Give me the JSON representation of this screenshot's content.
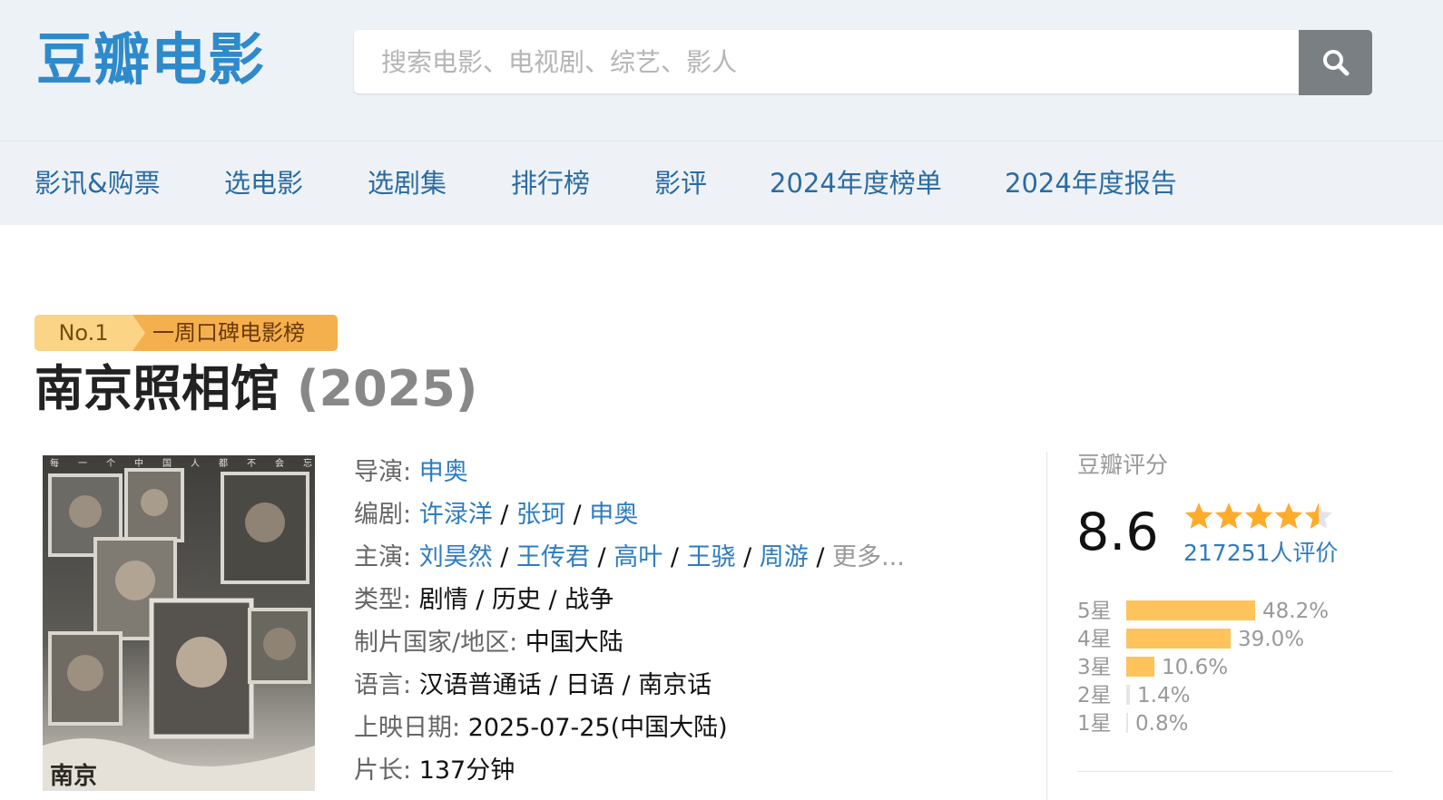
{
  "site": {
    "logo": "豆瓣电影"
  },
  "search": {
    "placeholder": "搜索电影、电视剧、综艺、影人",
    "value": ""
  },
  "nav": {
    "items": [
      {
        "label": "影讯&购票"
      },
      {
        "label": "选电影"
      },
      {
        "label": "选剧集"
      },
      {
        "label": "排行榜"
      },
      {
        "label": "影评"
      },
      {
        "label": "2024年度榜单"
      },
      {
        "label": "2024年度报告"
      }
    ]
  },
  "badge": {
    "rank": "No.1",
    "list": "一周口碑电影榜"
  },
  "movie": {
    "title": "南京照相馆",
    "year": "(2025)",
    "poster_text": "每一个中国人都不会忘记",
    "poster_title": "南京",
    "info": {
      "director_label": "导演:",
      "director": "申奥",
      "writer_label": "编剧:",
      "writers": [
        "许渌洋",
        "张珂",
        "申奥"
      ],
      "cast_label": "主演:",
      "cast": [
        "刘昊然",
        "王传君",
        "高叶",
        "王骁",
        "周游"
      ],
      "cast_more": "更多...",
      "genre_label": "类型:",
      "genres": [
        "剧情",
        "历史",
        "战争"
      ],
      "country_label": "制片国家/地区:",
      "country": "中国大陆",
      "language_label": "语言:",
      "languages": [
        "汉语普通话",
        "日语",
        "南京话"
      ],
      "release_label": "上映日期:",
      "release": "2025-07-25(中国大陆)",
      "runtime_label": "片长:",
      "runtime": "137分钟"
    }
  },
  "rating": {
    "title": "豆瓣评分",
    "score": "8.6",
    "stars": 4.5,
    "count": "217251人评价",
    "distribution": [
      {
        "label": "5星",
        "percent": "48.2%",
        "value": 48.2
      },
      {
        "label": "4星",
        "percent": "39.0%",
        "value": 39.0
      },
      {
        "label": "3星",
        "percent": "10.6%",
        "value": 10.6
      },
      {
        "label": "2星",
        "percent": "1.4%",
        "value": 1.4
      },
      {
        "label": "1星",
        "percent": "0.8%",
        "value": 0.8
      }
    ]
  },
  "colors": {
    "brand": "#2e8acb",
    "link": "#2e7cc0",
    "star": "#ffac2d",
    "bar": "#ffc35b",
    "badge_light": "#fbd486",
    "badge_dark": "#f5b04e"
  }
}
